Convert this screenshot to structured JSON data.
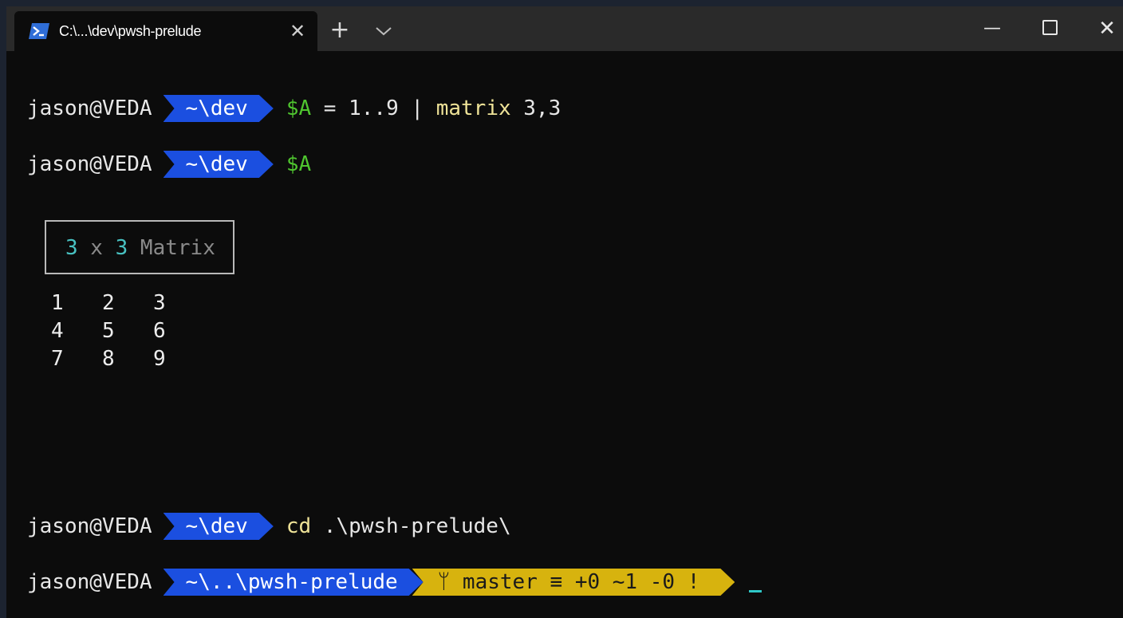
{
  "titlebar": {
    "tab_title": "C:\\...\\dev\\pwsh-prelude",
    "tab_close": "✕",
    "new_tab": "+",
    "minimize": "—",
    "close": "✕"
  },
  "prompt": {
    "user": "jason@VEDA",
    "dir": "~\\dev",
    "dir_repo": "~\\..\\pwsh-prelude"
  },
  "lines": {
    "l1_var": "$A",
    "l1_eq": " = ",
    "l1_range": "1..9",
    "l1_pipe": " | ",
    "l1_func": "matrix",
    "l1_args": " 3,3",
    "l2_var": "$A",
    "l3_cmd": "cd",
    "l3_arg": " .\\pwsh-prelude\\"
  },
  "matrix": {
    "rows_count": "3",
    "x": " x ",
    "cols_count": "3",
    "label": " Matrix",
    "rows": [
      [
        "1",
        "2",
        "3"
      ],
      [
        "4",
        "5",
        "6"
      ],
      [
        "7",
        "8",
        "9"
      ]
    ]
  },
  "git": {
    "branch_icon": "ᛘ",
    "branch": "master",
    "sync_icon": "≡",
    "status": "+0 ~1 -0 !"
  },
  "colors": {
    "prompt_dir_bg": "#1b4fe0",
    "git_bg": "#d7b30e",
    "variable": "#4fc52f",
    "command": "#efe398",
    "matrix_dims": "#48c2c2",
    "cursor": "#2fc7c7"
  }
}
